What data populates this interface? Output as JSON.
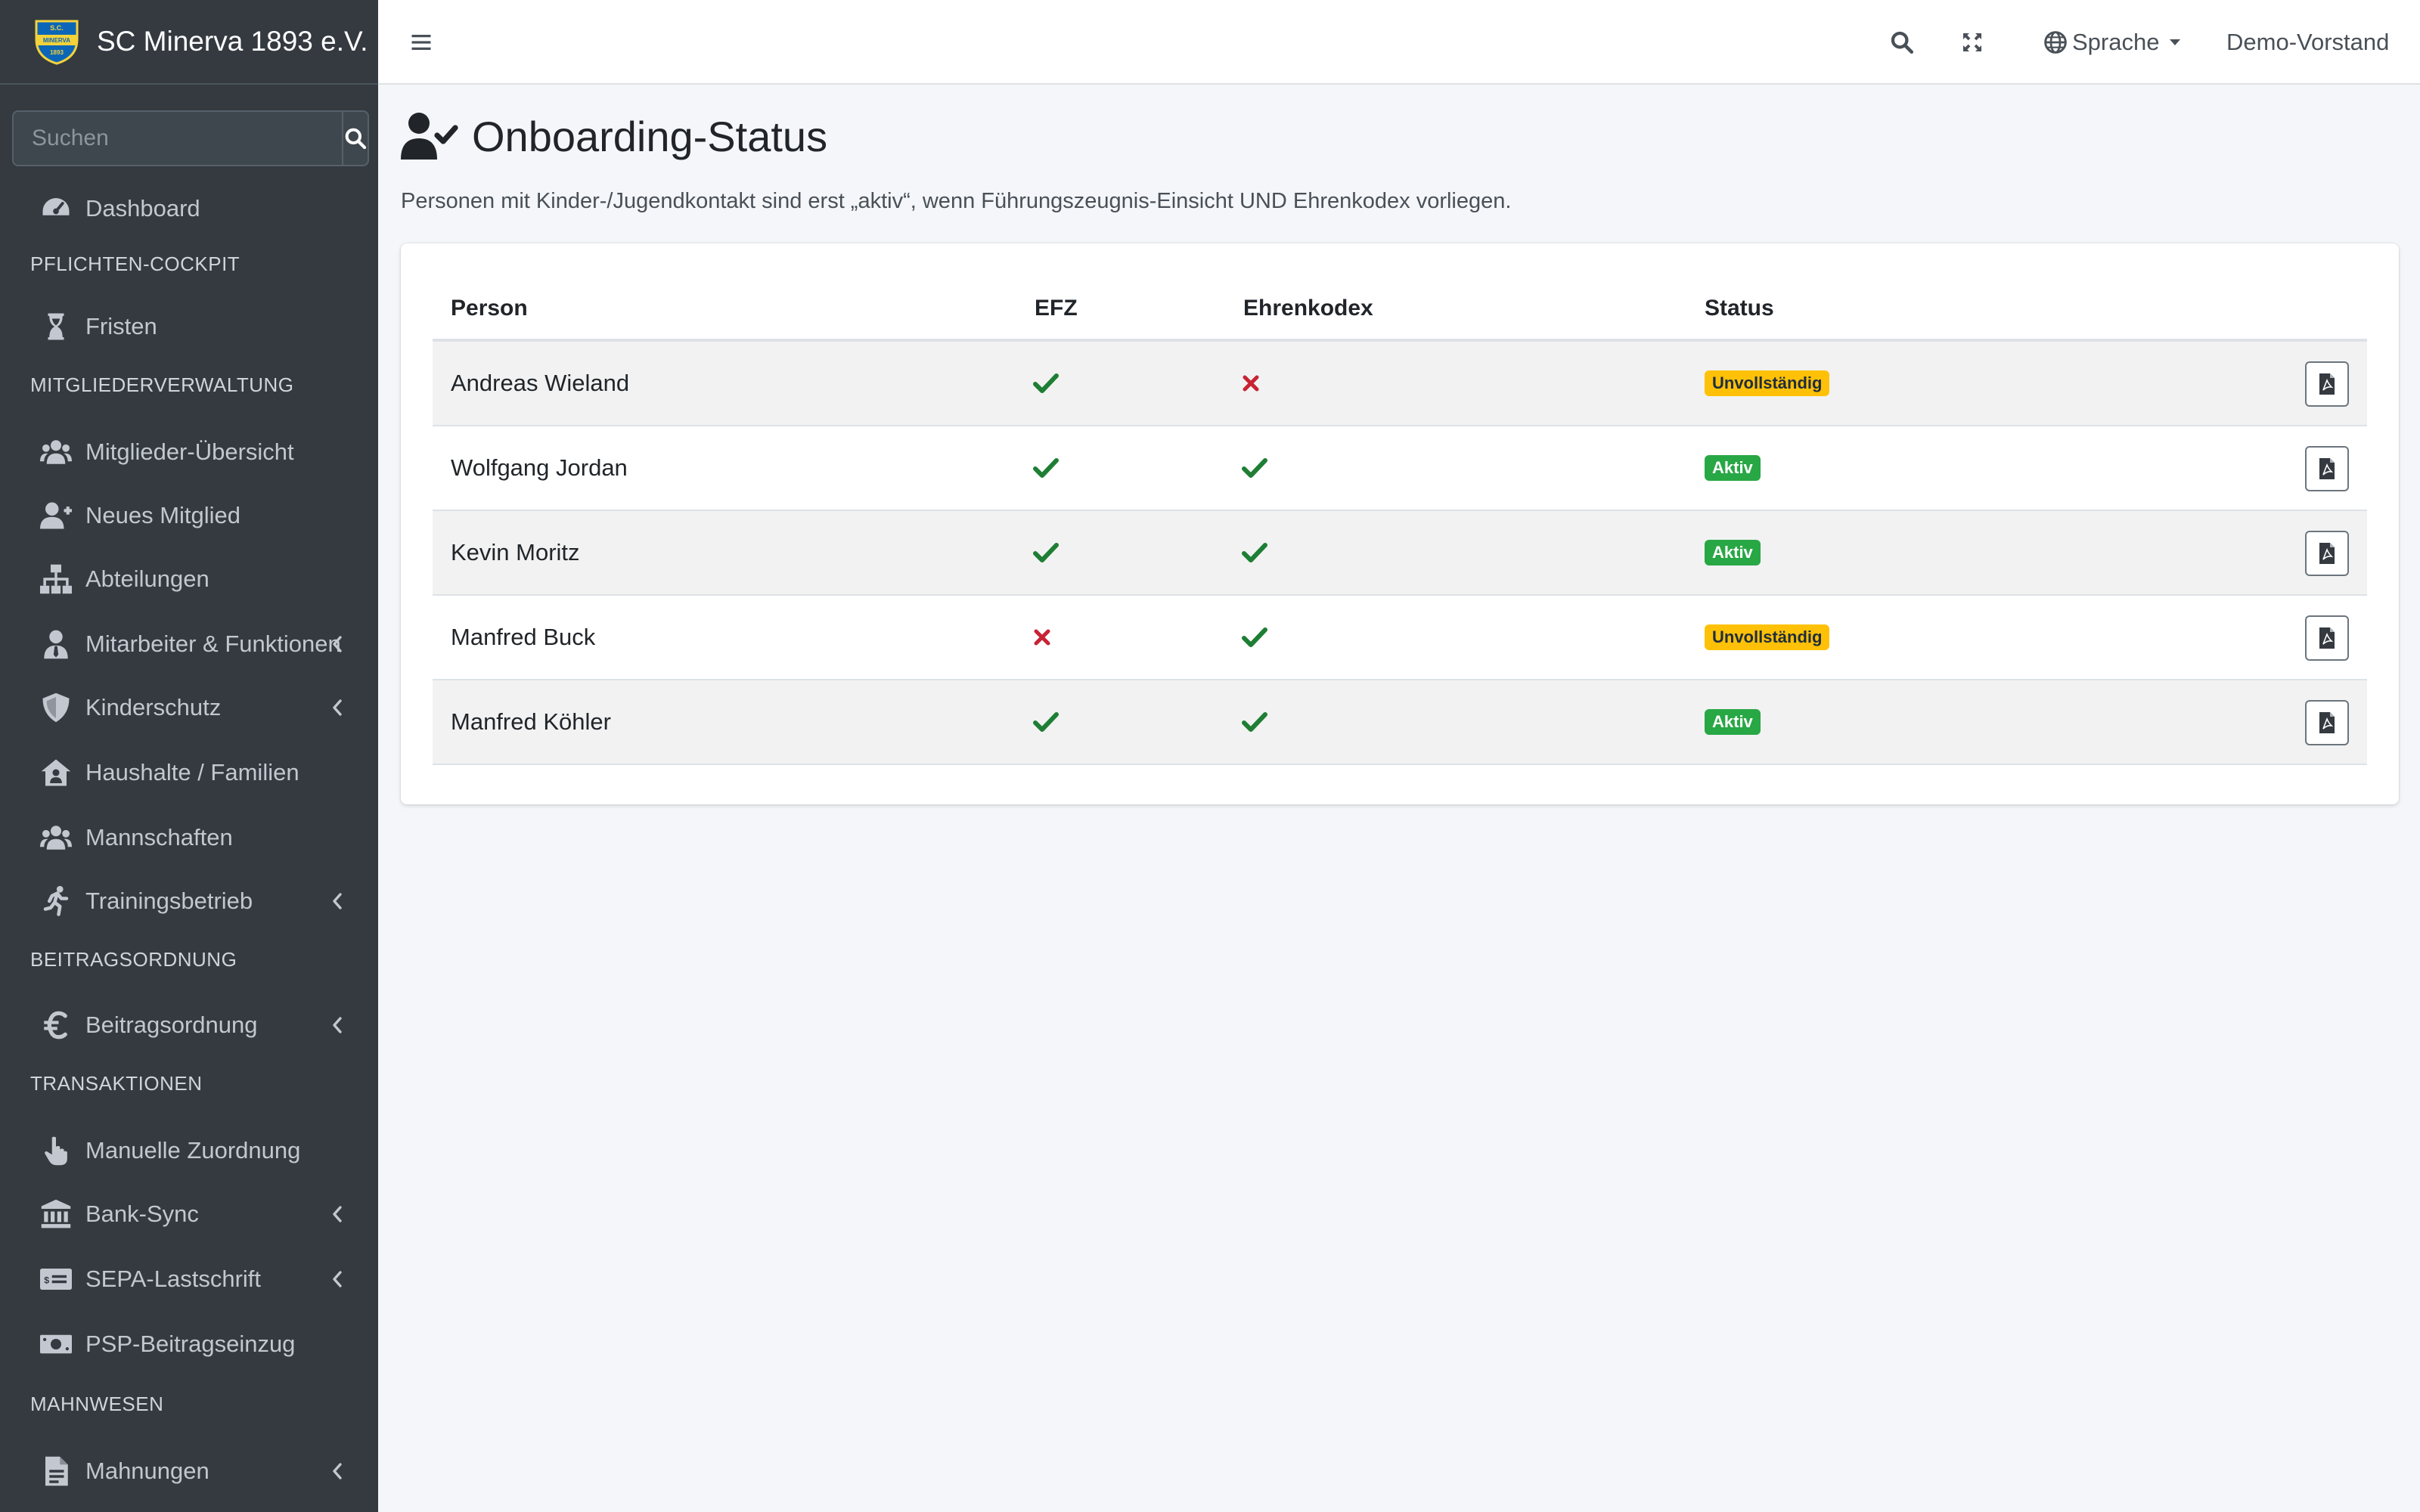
{
  "brand": {
    "name": "SC Minerva 1893 e.V.",
    "logo_text_top": "S.C.",
    "logo_text_mid": "MINERVA",
    "logo_text_bot": "1893"
  },
  "search": {
    "placeholder": "Suchen"
  },
  "sidebar": {
    "items": [
      {
        "type": "item",
        "label": "Dashboard",
        "icon": "tachometer-icon",
        "chevron": false
      },
      {
        "type": "header",
        "label": "PFLICHTEN-COCKPIT"
      },
      {
        "type": "item",
        "label": "Fristen",
        "icon": "hourglass-icon",
        "chevron": false
      },
      {
        "type": "header",
        "label": "MITGLIEDERVERWALTUNG"
      },
      {
        "type": "item",
        "label": "Mitglieder-Übersicht",
        "icon": "users-icon",
        "chevron": false
      },
      {
        "type": "item",
        "label": "Neues Mitglied",
        "icon": "user-plus-icon",
        "chevron": false
      },
      {
        "type": "item",
        "label": "Abteilungen",
        "icon": "sitemap-icon",
        "chevron": false
      },
      {
        "type": "item",
        "label": "Mitarbeiter & Funktionen",
        "icon": "user-tie-icon",
        "chevron": true
      },
      {
        "type": "item",
        "label": "Kinderschutz",
        "icon": "shield-icon",
        "chevron": true
      },
      {
        "type": "item",
        "label": "Haushalte / Familien",
        "icon": "house-user-icon",
        "chevron": false
      },
      {
        "type": "item",
        "label": "Mannschaften",
        "icon": "users-icon",
        "chevron": false
      },
      {
        "type": "item",
        "label": "Trainingsbetrieb",
        "icon": "running-icon",
        "chevron": true
      },
      {
        "type": "header",
        "label": "BEITRAGSORDNUNG"
      },
      {
        "type": "item",
        "label": "Beitragsordnung",
        "icon": "euro-icon",
        "chevron": true
      },
      {
        "type": "header",
        "label": "TRANSAKTIONEN"
      },
      {
        "type": "item",
        "label": "Manuelle Zuordnung",
        "icon": "hand-pointer-icon",
        "chevron": false
      },
      {
        "type": "item",
        "label": "Bank-Sync",
        "icon": "bank-icon",
        "chevron": true
      },
      {
        "type": "item",
        "label": "SEPA-Lastschrift",
        "icon": "money-check-icon",
        "chevron": true
      },
      {
        "type": "item",
        "label": "PSP-Beitragseinzug",
        "icon": "money-bill-icon",
        "chevron": false
      },
      {
        "type": "header",
        "label": "MAHNWESEN"
      },
      {
        "type": "item",
        "label": "Mahnungen",
        "icon": "file-alt-icon",
        "chevron": true
      }
    ]
  },
  "topbar": {
    "language_label": "Sprache",
    "user_label": "Demo-Vorstand"
  },
  "page": {
    "title": "Onboarding-Status",
    "description": "Personen mit Kinder-/Jugendkontakt sind erst „aktiv“, wenn Führungszeugnis-Einsicht UND Ehrenkodex vorliegen."
  },
  "table": {
    "headers": {
      "person": "Person",
      "efz": "EFZ",
      "ehrenkodex": "Ehrenkodex",
      "status": "Status"
    },
    "rows": [
      {
        "person": "Andreas Wieland",
        "efz": true,
        "ehrenkodex": false,
        "status": "Unvollständig",
        "status_type": "warning"
      },
      {
        "person": "Wolfgang Jordan",
        "efz": true,
        "ehrenkodex": true,
        "status": "Aktiv",
        "status_type": "success"
      },
      {
        "person": "Kevin Moritz",
        "efz": true,
        "ehrenkodex": true,
        "status": "Aktiv",
        "status_type": "success"
      },
      {
        "person": "Manfred Buck",
        "efz": false,
        "ehrenkodex": true,
        "status": "Unvollständig",
        "status_type": "warning"
      },
      {
        "person": "Manfred Köhler",
        "efz": true,
        "ehrenkodex": true,
        "status": "Aktiv",
        "status_type": "success"
      }
    ]
  },
  "colors": {
    "sidebar_bg": "#343a40",
    "check": "#1e7e34",
    "cross": "#c82333",
    "warning": "#ffc107",
    "success": "#28a745"
  }
}
